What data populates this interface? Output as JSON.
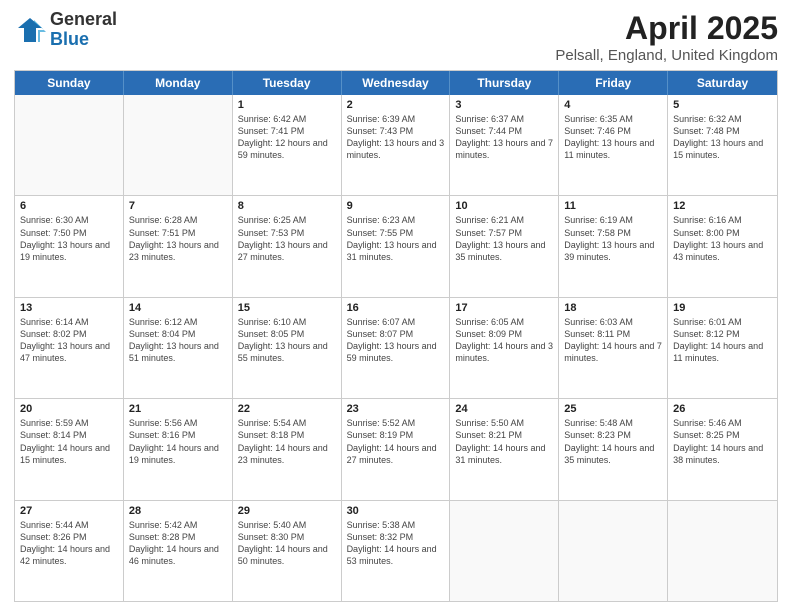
{
  "logo": {
    "general": "General",
    "blue": "Blue"
  },
  "title": {
    "month": "April 2025",
    "location": "Pelsall, England, United Kingdom"
  },
  "days": [
    "Sunday",
    "Monday",
    "Tuesday",
    "Wednesday",
    "Thursday",
    "Friday",
    "Saturday"
  ],
  "rows": [
    [
      {
        "day": "",
        "info": ""
      },
      {
        "day": "",
        "info": ""
      },
      {
        "day": "1",
        "info": "Sunrise: 6:42 AM\nSunset: 7:41 PM\nDaylight: 12 hours and 59 minutes."
      },
      {
        "day": "2",
        "info": "Sunrise: 6:39 AM\nSunset: 7:43 PM\nDaylight: 13 hours and 3 minutes."
      },
      {
        "day": "3",
        "info": "Sunrise: 6:37 AM\nSunset: 7:44 PM\nDaylight: 13 hours and 7 minutes."
      },
      {
        "day": "4",
        "info": "Sunrise: 6:35 AM\nSunset: 7:46 PM\nDaylight: 13 hours and 11 minutes."
      },
      {
        "day": "5",
        "info": "Sunrise: 6:32 AM\nSunset: 7:48 PM\nDaylight: 13 hours and 15 minutes."
      }
    ],
    [
      {
        "day": "6",
        "info": "Sunrise: 6:30 AM\nSunset: 7:50 PM\nDaylight: 13 hours and 19 minutes."
      },
      {
        "day": "7",
        "info": "Sunrise: 6:28 AM\nSunset: 7:51 PM\nDaylight: 13 hours and 23 minutes."
      },
      {
        "day": "8",
        "info": "Sunrise: 6:25 AM\nSunset: 7:53 PM\nDaylight: 13 hours and 27 minutes."
      },
      {
        "day": "9",
        "info": "Sunrise: 6:23 AM\nSunset: 7:55 PM\nDaylight: 13 hours and 31 minutes."
      },
      {
        "day": "10",
        "info": "Sunrise: 6:21 AM\nSunset: 7:57 PM\nDaylight: 13 hours and 35 minutes."
      },
      {
        "day": "11",
        "info": "Sunrise: 6:19 AM\nSunset: 7:58 PM\nDaylight: 13 hours and 39 minutes."
      },
      {
        "day": "12",
        "info": "Sunrise: 6:16 AM\nSunset: 8:00 PM\nDaylight: 13 hours and 43 minutes."
      }
    ],
    [
      {
        "day": "13",
        "info": "Sunrise: 6:14 AM\nSunset: 8:02 PM\nDaylight: 13 hours and 47 minutes."
      },
      {
        "day": "14",
        "info": "Sunrise: 6:12 AM\nSunset: 8:04 PM\nDaylight: 13 hours and 51 minutes."
      },
      {
        "day": "15",
        "info": "Sunrise: 6:10 AM\nSunset: 8:05 PM\nDaylight: 13 hours and 55 minutes."
      },
      {
        "day": "16",
        "info": "Sunrise: 6:07 AM\nSunset: 8:07 PM\nDaylight: 13 hours and 59 minutes."
      },
      {
        "day": "17",
        "info": "Sunrise: 6:05 AM\nSunset: 8:09 PM\nDaylight: 14 hours and 3 minutes."
      },
      {
        "day": "18",
        "info": "Sunrise: 6:03 AM\nSunset: 8:11 PM\nDaylight: 14 hours and 7 minutes."
      },
      {
        "day": "19",
        "info": "Sunrise: 6:01 AM\nSunset: 8:12 PM\nDaylight: 14 hours and 11 minutes."
      }
    ],
    [
      {
        "day": "20",
        "info": "Sunrise: 5:59 AM\nSunset: 8:14 PM\nDaylight: 14 hours and 15 minutes."
      },
      {
        "day": "21",
        "info": "Sunrise: 5:56 AM\nSunset: 8:16 PM\nDaylight: 14 hours and 19 minutes."
      },
      {
        "day": "22",
        "info": "Sunrise: 5:54 AM\nSunset: 8:18 PM\nDaylight: 14 hours and 23 minutes."
      },
      {
        "day": "23",
        "info": "Sunrise: 5:52 AM\nSunset: 8:19 PM\nDaylight: 14 hours and 27 minutes."
      },
      {
        "day": "24",
        "info": "Sunrise: 5:50 AM\nSunset: 8:21 PM\nDaylight: 14 hours and 31 minutes."
      },
      {
        "day": "25",
        "info": "Sunrise: 5:48 AM\nSunset: 8:23 PM\nDaylight: 14 hours and 35 minutes."
      },
      {
        "day": "26",
        "info": "Sunrise: 5:46 AM\nSunset: 8:25 PM\nDaylight: 14 hours and 38 minutes."
      }
    ],
    [
      {
        "day": "27",
        "info": "Sunrise: 5:44 AM\nSunset: 8:26 PM\nDaylight: 14 hours and 42 minutes."
      },
      {
        "day": "28",
        "info": "Sunrise: 5:42 AM\nSunset: 8:28 PM\nDaylight: 14 hours and 46 minutes."
      },
      {
        "day": "29",
        "info": "Sunrise: 5:40 AM\nSunset: 8:30 PM\nDaylight: 14 hours and 50 minutes."
      },
      {
        "day": "30",
        "info": "Sunrise: 5:38 AM\nSunset: 8:32 PM\nDaylight: 14 hours and 53 minutes."
      },
      {
        "day": "",
        "info": ""
      },
      {
        "day": "",
        "info": ""
      },
      {
        "day": "",
        "info": ""
      }
    ]
  ]
}
